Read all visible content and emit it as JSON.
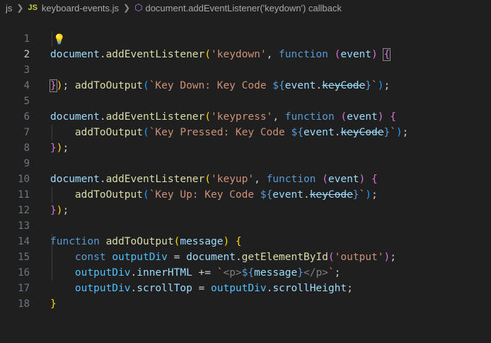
{
  "breadcrumb": {
    "folder": "js",
    "file_badge": "JS",
    "file": "keyboard-events.js",
    "symbol": "document.addEventListener('keydown') callback"
  },
  "editor": {
    "active_line": 2,
    "lines": [
      {
        "n": "1"
      },
      {
        "n": "2"
      },
      {
        "n": "3"
      },
      {
        "n": "4"
      },
      {
        "n": "5"
      },
      {
        "n": "6"
      },
      {
        "n": "7"
      },
      {
        "n": "8"
      },
      {
        "n": "9"
      },
      {
        "n": "10"
      },
      {
        "n": "11"
      },
      {
        "n": "12"
      },
      {
        "n": "13"
      },
      {
        "n": "14"
      },
      {
        "n": "15"
      },
      {
        "n": "16"
      },
      {
        "n": "17"
      },
      {
        "n": "18"
      }
    ],
    "code": {
      "document": "document",
      "addEventListener": "addEventListener",
      "function_kw": "function",
      "event": "event",
      "addToOutput": "addToOutput",
      "keyCode": "keyCode",
      "evt_keydown": "'keydown'",
      "evt_keypress": "'keypress'",
      "evt_keyup": "'keyup'",
      "tpl_down": "Key Down: Key Code ",
      "tpl_pressed": "Key Pressed: Key Code ",
      "tpl_up": "Key Up: Key Code ",
      "message": "message",
      "const_kw": "const",
      "outputDiv": "outputDiv",
      "getElementById": "getElementById",
      "output_id": "'output'",
      "innerHTML": "innerHTML",
      "tag_open": "<p>",
      "tag_close": "</p>",
      "scrollTop": "scrollTop",
      "scrollHeight": "scrollHeight"
    }
  },
  "colors": {
    "background": "#1f1f1f",
    "keyword": "#569cd6",
    "function": "#dcdcaa",
    "variable": "#9cdcfe",
    "string": "#ce9178",
    "bracket_level1": "#ffd700",
    "bracket_level2": "#da70d6",
    "bracket_level3": "#179fff"
  },
  "icons": {
    "folder_chevron": "chevron-right-icon",
    "symbol": "method-cube-icon",
    "lightbulb": "lightbulb-icon"
  }
}
